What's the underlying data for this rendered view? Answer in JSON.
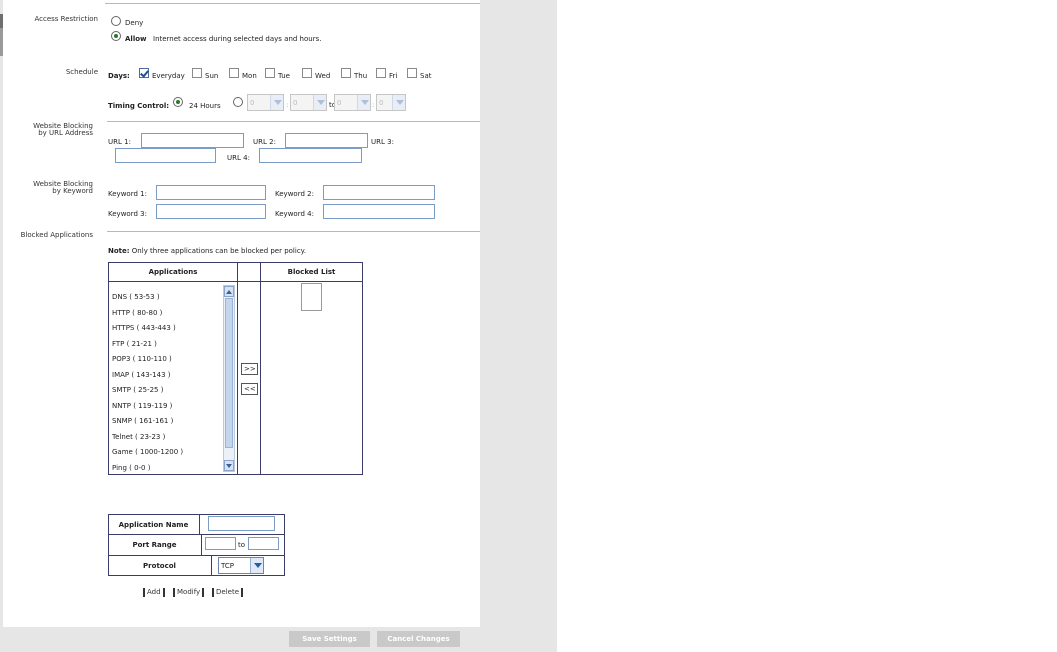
{
  "access": {
    "label": "Access Restriction",
    "deny_label": "Deny",
    "allow_label": "Allow",
    "allow_desc": "Internet access during selected days and hours.",
    "selected": "Allow"
  },
  "schedule": {
    "label": "Schedule",
    "days_label": "Days:",
    "days": [
      {
        "label": "Everyday",
        "checked": true
      },
      {
        "label": "Sun",
        "checked": false
      },
      {
        "label": "Mon",
        "checked": false
      },
      {
        "label": "Tue",
        "checked": false
      },
      {
        "label": "Wed",
        "checked": false
      },
      {
        "label": "Thu",
        "checked": false
      },
      {
        "label": "Fri",
        "checked": false
      },
      {
        "label": "Sat",
        "checked": false
      }
    ],
    "timing_label": "Timing Control:",
    "hours_label": "24 Hours",
    "time_values": [
      "0",
      "0",
      "0",
      "0"
    ],
    "colon": ":",
    "to_label": "to"
  },
  "url_blocking": {
    "label_line1": "Website Blocking",
    "label_line2": "by URL Address",
    "url1": "URL 1:",
    "url2": "URL 2:",
    "url3": "URL 3:",
    "url4": "URL 4:"
  },
  "keyword_blocking": {
    "label_line1": "Website Blocking",
    "label_line2": "by Keyword",
    "kw1": "Keyword 1:",
    "kw2": "Keyword 2:",
    "kw3": "Keyword 3:",
    "kw4": "Keyword 4:"
  },
  "blocked_apps": {
    "label": "Blocked Applications",
    "note_bold": "Note:",
    "note_text": "Only three applications can be blocked per policy.",
    "col_applications": "Applications",
    "col_blocked": "Blocked List",
    "applications": [
      "DNS ( 53-53 )",
      "HTTP ( 80-80 )",
      "HTTPS ( 443-443 )",
      "FTP ( 21-21 )",
      "POP3 ( 110-110 )",
      "IMAP ( 143-143 )",
      "SMTP ( 25-25 )",
      "NNTP ( 119-119 )",
      "SNMP ( 161-161 )",
      "Telnet ( 23-23 )",
      "Game ( 1000-1200 )",
      "Ping ( 0-0 )"
    ],
    "add_arrow": ">>",
    "remove_arrow": "<<"
  },
  "app_form": {
    "name_label": "Application Name",
    "range_label": "Port Range",
    "range_to": "to",
    "protocol_label": "Protocol",
    "protocol_value": "TCP",
    "add": "Add",
    "modify": "Modify",
    "delete": "Delete"
  },
  "footer": {
    "save": "Save Settings",
    "cancel": "Cancel Changes"
  }
}
